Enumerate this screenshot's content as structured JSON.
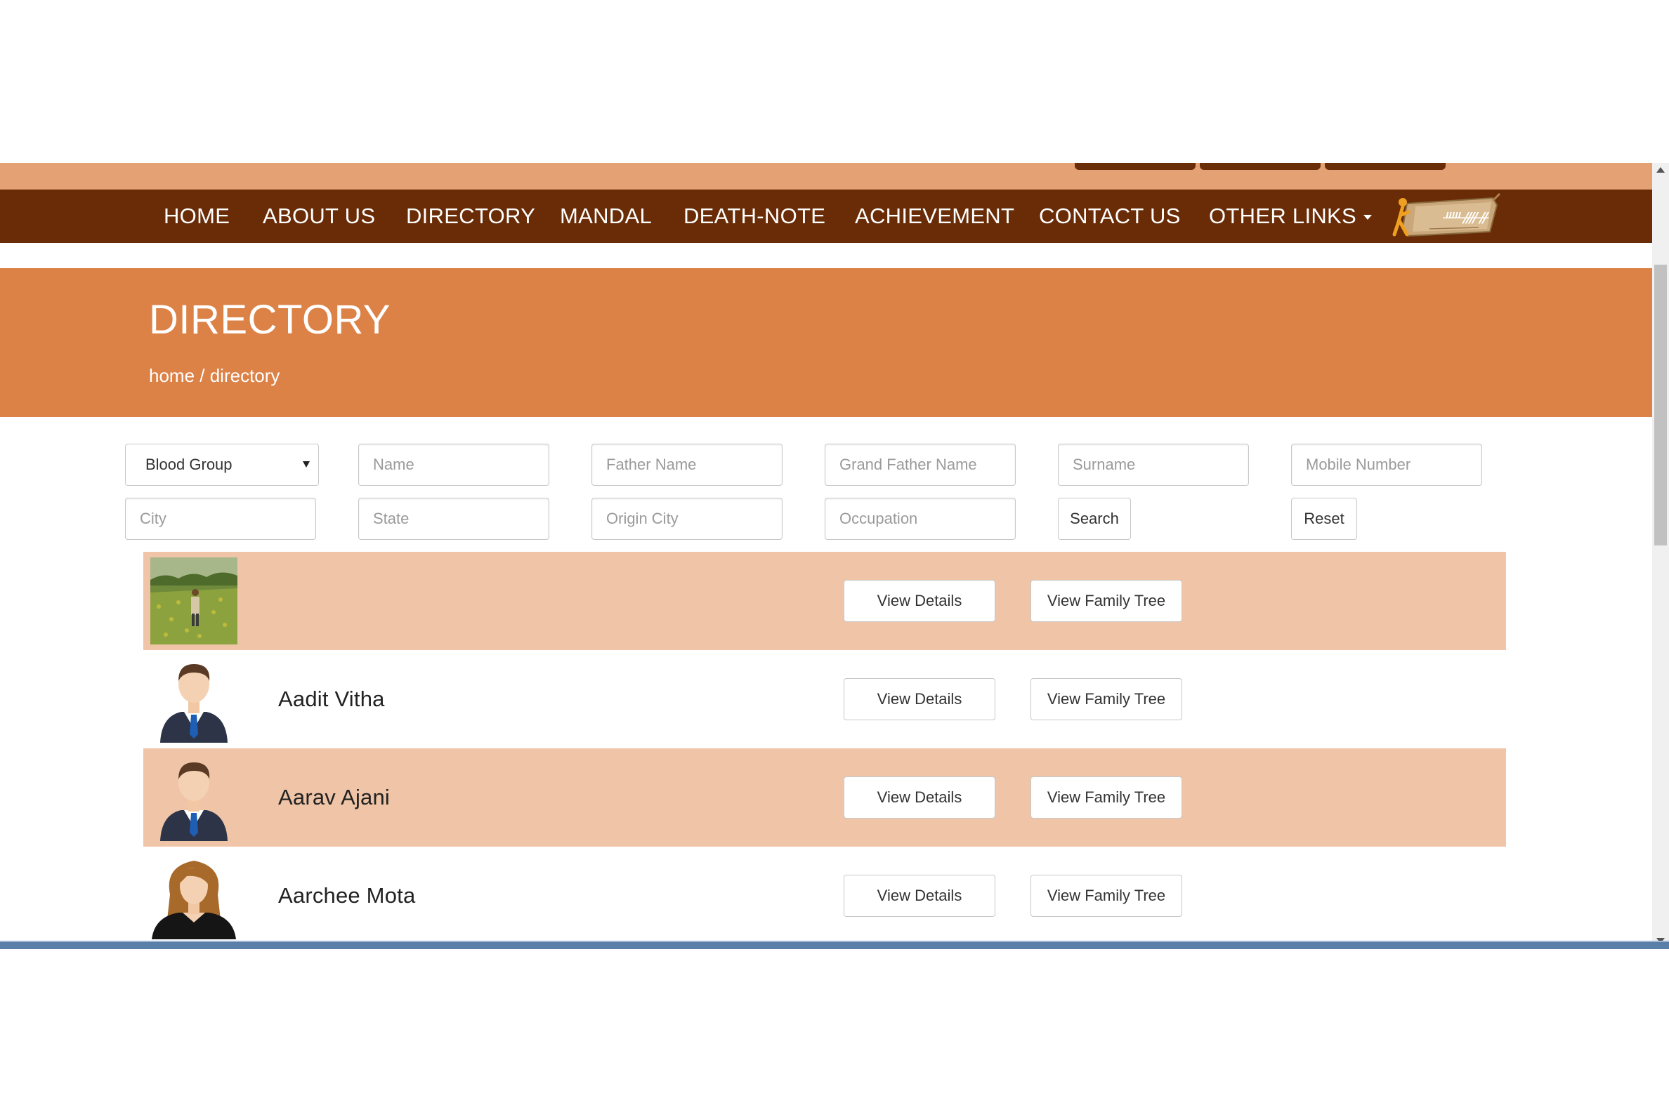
{
  "nav": {
    "items": [
      "HOME",
      "ABOUT US",
      "DIRECTORY",
      "MANDAL",
      "DEATH-NOTE",
      "ACHIEVEMENT",
      "CONTACT US",
      "OTHER LINKS"
    ],
    "logo_icon": "brand-logo-icon"
  },
  "banner": {
    "title": "DIRECTORY",
    "breadcrumb": "home / directory"
  },
  "filters": {
    "blood_group": "Blood Group",
    "name": "Name",
    "father_name": "Father Name",
    "grand_father_name": "Grand Father Name",
    "surname": "Surname",
    "mobile_number": "Mobile Number",
    "city": "City",
    "state": "State",
    "origin_city": "Origin City",
    "occupation": "Occupation",
    "search_label": "Search",
    "reset_label": "Reset"
  },
  "members": [
    {
      "name": "",
      "photo": "field-photo"
    },
    {
      "name": "Aadit Vitha",
      "photo": "male-avatar-icon"
    },
    {
      "name": "Aarav Ajani",
      "photo": "male-avatar-icon"
    },
    {
      "name": "Aarchee Mota",
      "photo": "female-avatar-icon"
    }
  ],
  "row_actions": {
    "view_details": "View Details",
    "view_family_tree": "View Family Tree"
  },
  "colors": {
    "nav_bg": "#692c07",
    "top_strip": "#e4a274",
    "banner_bg": "#dc8247",
    "row_alt": "#efc4a7"
  }
}
